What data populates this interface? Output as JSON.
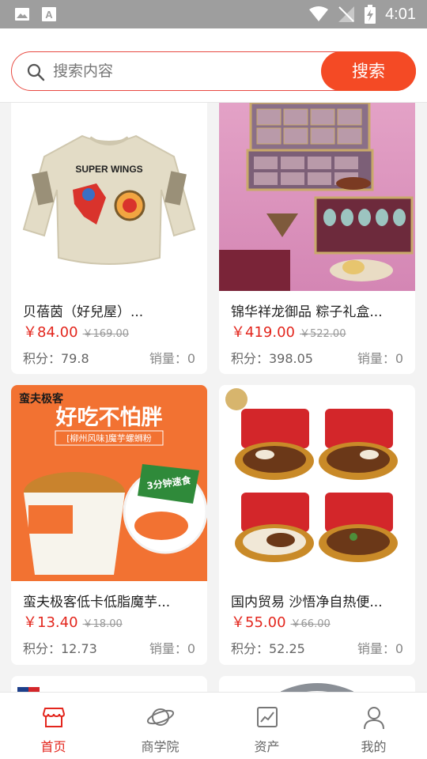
{
  "status_bar": {
    "time": "4:01"
  },
  "search": {
    "placeholder": "搜索内容",
    "button_label": "搜索"
  },
  "products": [
    {
      "title": "贝蓓茵（好兒屋）...",
      "price": "￥84.00",
      "original_price": "￥169.00",
      "points": "积分：79.8",
      "sales": "销量：0",
      "image_text": "SUPER WINGS"
    },
    {
      "title": "锦华祥龙御品 粽子礼盒...",
      "price": "￥419.00",
      "original_price": "￥522.00",
      "points": "积分：398.05",
      "sales": "销量：0"
    },
    {
      "title": "蛮夫极客低卡低脂魔芋...",
      "price": "￥13.40",
      "original_price": "￥18.00",
      "points": "积分：12.73",
      "sales": "销量：0",
      "image_brand": "蛮夫极客",
      "image_headline": "好吃不怕胖",
      "image_sub": "[柳州风味]魔芋螺蛳粉",
      "image_badge": "3分钟速食"
    },
    {
      "title": "国内贸易 沙悟净自热便...",
      "price": "￥55.00",
      "original_price": "￥66.00",
      "points": "积分：52.25",
      "sales": "销量：0"
    }
  ],
  "tabbar": [
    {
      "label": "首页",
      "icon": "shop-icon",
      "active": true
    },
    {
      "label": "商学院",
      "icon": "planet-icon",
      "active": false
    },
    {
      "label": "资产",
      "icon": "chart-icon",
      "active": false
    },
    {
      "label": "我的",
      "icon": "person-icon",
      "active": false
    }
  ],
  "colors": {
    "accent": "#f44a25",
    "price": "#e3261d",
    "status_bar": "#9e9e9e"
  }
}
